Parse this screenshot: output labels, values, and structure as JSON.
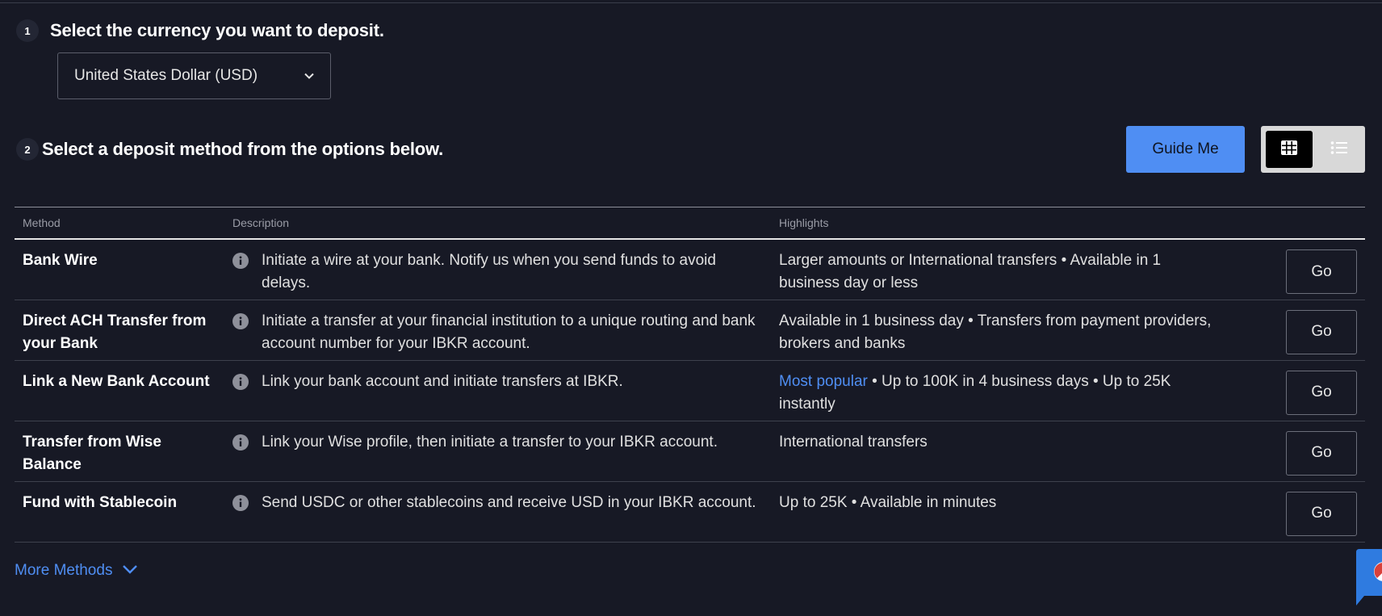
{
  "step1": {
    "number": "1",
    "title": "Select the currency you want to deposit.",
    "currency_selected": "United States Dollar (USD)"
  },
  "step2": {
    "number": "2",
    "title": "Select a deposit method from the options below.",
    "guide_button": "Guide Me",
    "view_modes": [
      "grid-icon",
      "list-icon"
    ],
    "active_view": "grid"
  },
  "table": {
    "headers": [
      "Method",
      "Description",
      "Highlights"
    ],
    "rows": [
      {
        "method": "Bank Wire",
        "description": "Initiate a wire at your bank. Notify us when you send funds to avoid delays.",
        "highlight_prefix": "",
        "highlight": "Larger amounts or International transfers • Available in 1 business day or less",
        "action": "Go"
      },
      {
        "method": "Direct ACH Transfer from your Bank",
        "description": "Initiate a transfer at your financial institution to a unique routing and bank account number for your IBKR account.",
        "highlight_prefix": "",
        "highlight": "Available in 1 business day • Transfers from payment providers, brokers and banks",
        "action": "Go"
      },
      {
        "method": "Link a New Bank Account",
        "description": "Link your bank account and initiate transfers at IBKR.",
        "highlight_prefix": "Most popular",
        "highlight": " • Up to 100K in 4 business days • Up to 25K instantly",
        "action": "Go"
      },
      {
        "method": "Transfer from Wise Balance",
        "description": "Link your Wise profile, then initiate a transfer to your IBKR account.",
        "highlight_prefix": "",
        "highlight": "International transfers",
        "action": "Go"
      },
      {
        "method": "Fund with Stablecoin",
        "description": "Send USDC or other stablecoins and receive USD in your IBKR account.",
        "highlight_prefix": "",
        "highlight": "Up to 25K • Available in minutes",
        "action": "Go"
      }
    ]
  },
  "more_methods": "More Methods",
  "colors": {
    "background": "#171925",
    "accent": "#4f8ef3",
    "text": "#e6e6e6"
  }
}
